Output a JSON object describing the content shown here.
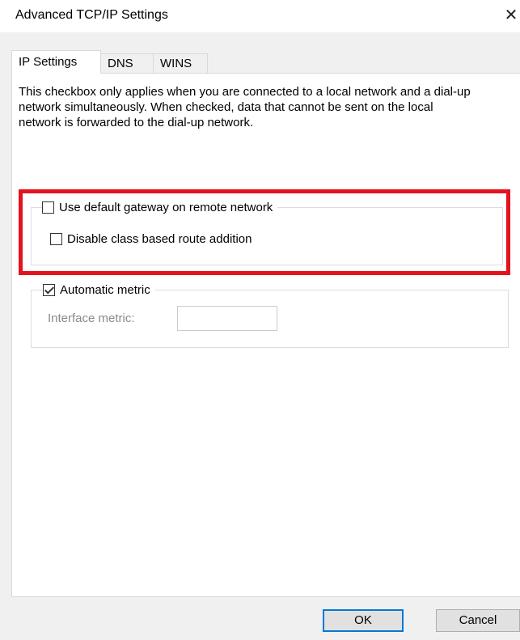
{
  "window": {
    "title": "Advanced TCP/IP Settings",
    "close_glyph": "✕"
  },
  "tabs": [
    {
      "label": "IP Settings",
      "active": true
    },
    {
      "label": "DNS",
      "active": false
    },
    {
      "label": "WINS",
      "active": false
    }
  ],
  "description": "This checkbox only applies when you are connected to a local network and a dial-up network simultaneously.  When checked, data that cannot be sent on the local network is forwarded to the dial-up network.",
  "gateway_group": {
    "use_default_gateway": {
      "label": "Use default gateway on remote network",
      "checked": false
    },
    "disable_class_route": {
      "label": "Disable class based route addition",
      "checked": false
    }
  },
  "metric_group": {
    "automatic_metric": {
      "label": "Automatic metric",
      "checked": true
    },
    "interface_metric_label": "Interface metric:",
    "interface_metric_value": ""
  },
  "buttons": {
    "ok": "OK",
    "cancel": "Cancel"
  },
  "colors": {
    "highlight": "#e3141e",
    "default_button_border": "#0078d7"
  }
}
